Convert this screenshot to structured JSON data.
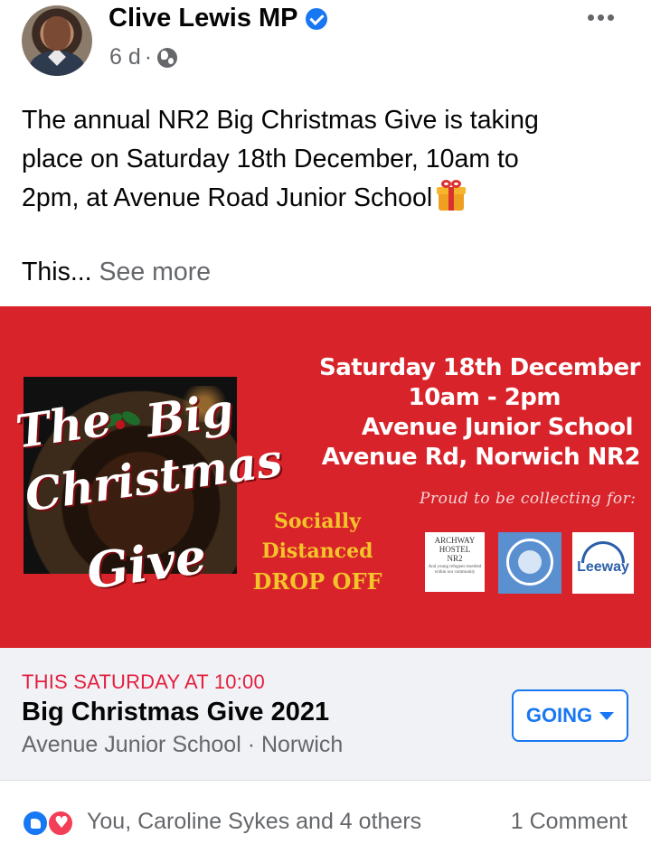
{
  "post": {
    "author": "Clive Lewis MP",
    "time": "6 d",
    "separator": "·",
    "text_lines": [
      "The annual NR2 Big Christmas Give is taking",
      "place on Saturday 18th December, 10am to",
      "2pm, at Avenue Road Junior School"
    ],
    "text_truncated": "This...",
    "see_more": "See more"
  },
  "banner": {
    "title_words": [
      "The",
      "Big",
      "Christmas",
      "Give"
    ],
    "dropoff": [
      "Socially",
      "Distanced",
      "DROP OFF"
    ],
    "details": [
      "Saturday 18th December",
      "10am - 2pm",
      "Avenue Junior School",
      "Avenue Rd, Norwich NR2"
    ],
    "proud": "Proud to be collecting for:",
    "archway": {
      "lines": [
        "ARCHWAY",
        "HOSTEL",
        "NR2"
      ],
      "small": "And young refugees resettled within our community"
    },
    "leeway": "Leeway",
    "colors": {
      "background": "#d8232a",
      "dropoff_text": "#f3c52a"
    }
  },
  "event": {
    "when": "THIS SATURDAY AT 10:00",
    "title": "Big Christmas Give 2021",
    "place": "Avenue Junior School · Norwich",
    "rsvp_label": "GOING",
    "accent": "#1877f2",
    "when_color": "#e41e3f"
  },
  "reactions": {
    "summary": "You, Caroline Sykes and 4 others",
    "comments": "1 Comment",
    "icons": [
      "like-icon",
      "love-icon"
    ]
  }
}
